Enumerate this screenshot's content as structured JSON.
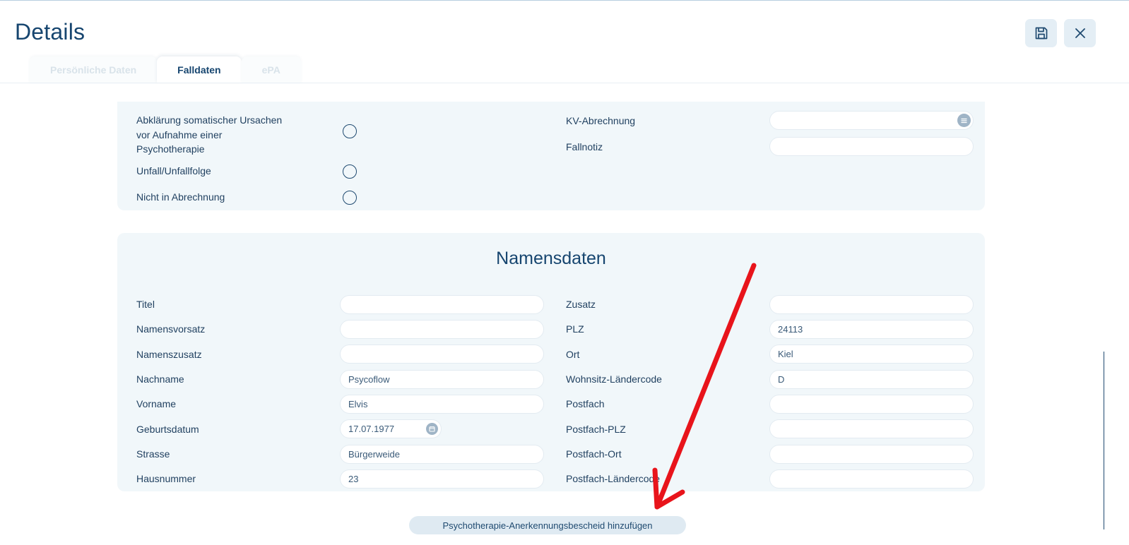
{
  "header": {
    "title": "Details"
  },
  "tabs": [
    {
      "label": "Persönliche Daten",
      "state": "inactive"
    },
    {
      "label": "Falldaten",
      "state": "active"
    },
    {
      "label": "ePA",
      "state": "inactive"
    }
  ],
  "case_section": {
    "checks": [
      {
        "label": "Abklärung somatischer Ursachen\n vor Aufnahme einer\nPsychotherapie",
        "checked": false
      },
      {
        "label": "Unfall/Unfallfolge",
        "checked": false
      },
      {
        "label": "Nicht in Abrechnung",
        "checked": false
      }
    ],
    "fields": [
      {
        "label": "KV-Abrechnung",
        "value": ""
      },
      {
        "label": "Fallnotiz",
        "value": ""
      }
    ]
  },
  "name_section": {
    "title": "Namensdaten",
    "left_fields": [
      {
        "label": "Titel",
        "value": ""
      },
      {
        "label": "Namensvorsatz",
        "value": ""
      },
      {
        "label": "Namenszusatz",
        "value": ""
      },
      {
        "label": "Nachname",
        "value": "Psycoflow"
      },
      {
        "label": "Vorname",
        "value": "Elvis"
      },
      {
        "label": "Geburtsdatum",
        "value": "17.07.1977"
      },
      {
        "label": "Strasse",
        "value": "Bürgerweide"
      },
      {
        "label": "Hausnummer",
        "value": "23"
      }
    ],
    "right_fields": [
      {
        "label": "Zusatz",
        "value": ""
      },
      {
        "label": "PLZ",
        "value": "24113"
      },
      {
        "label": "Ort",
        "value": "Kiel"
      },
      {
        "label": "Wohnsitz-Ländercode",
        "value": "D"
      },
      {
        "label": "Postfach",
        "value": ""
      },
      {
        "label": "Postfach-PLZ",
        "value": ""
      },
      {
        "label": "Postfach-Ort",
        "value": ""
      },
      {
        "label": "Postfach-Ländercode",
        "value": ""
      }
    ]
  },
  "actions": {
    "add_recognition": "Psychotherapie-Anerkennungsbescheid hinzufügen"
  },
  "icons": {
    "save": "save-icon",
    "close": "close-icon",
    "list": "list-icon",
    "calendar": "calendar-icon"
  },
  "colors": {
    "primary": "#16456f",
    "panel_background": "#f1f7fa",
    "annotation_arrow": "#e8141b"
  }
}
